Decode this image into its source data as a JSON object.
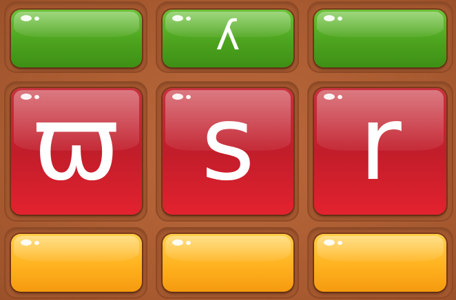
{
  "colors": {
    "frame": "#a85a30",
    "green": "#4fa620",
    "red": "#c11d2a",
    "orange": "#ffb21f",
    "glyph": "#ffffff"
  },
  "board": {
    "rows": [
      {
        "color": "green",
        "tiles": [
          {
            "glyph": "",
            "flipped": false
          },
          {
            "glyph": "у",
            "flipped": true
          },
          {
            "glyph": "",
            "flipped": false
          }
        ]
      },
      {
        "color": "red",
        "tiles": [
          {
            "glyph": "ϖ",
            "flipped": false
          },
          {
            "glyph": "s",
            "flipped": false
          },
          {
            "glyph": "r",
            "flipped": false
          }
        ]
      },
      {
        "color": "orange",
        "tiles": [
          {
            "glyph": "",
            "flipped": false
          },
          {
            "glyph": "",
            "flipped": false
          },
          {
            "glyph": "",
            "flipped": false
          }
        ]
      }
    ]
  }
}
